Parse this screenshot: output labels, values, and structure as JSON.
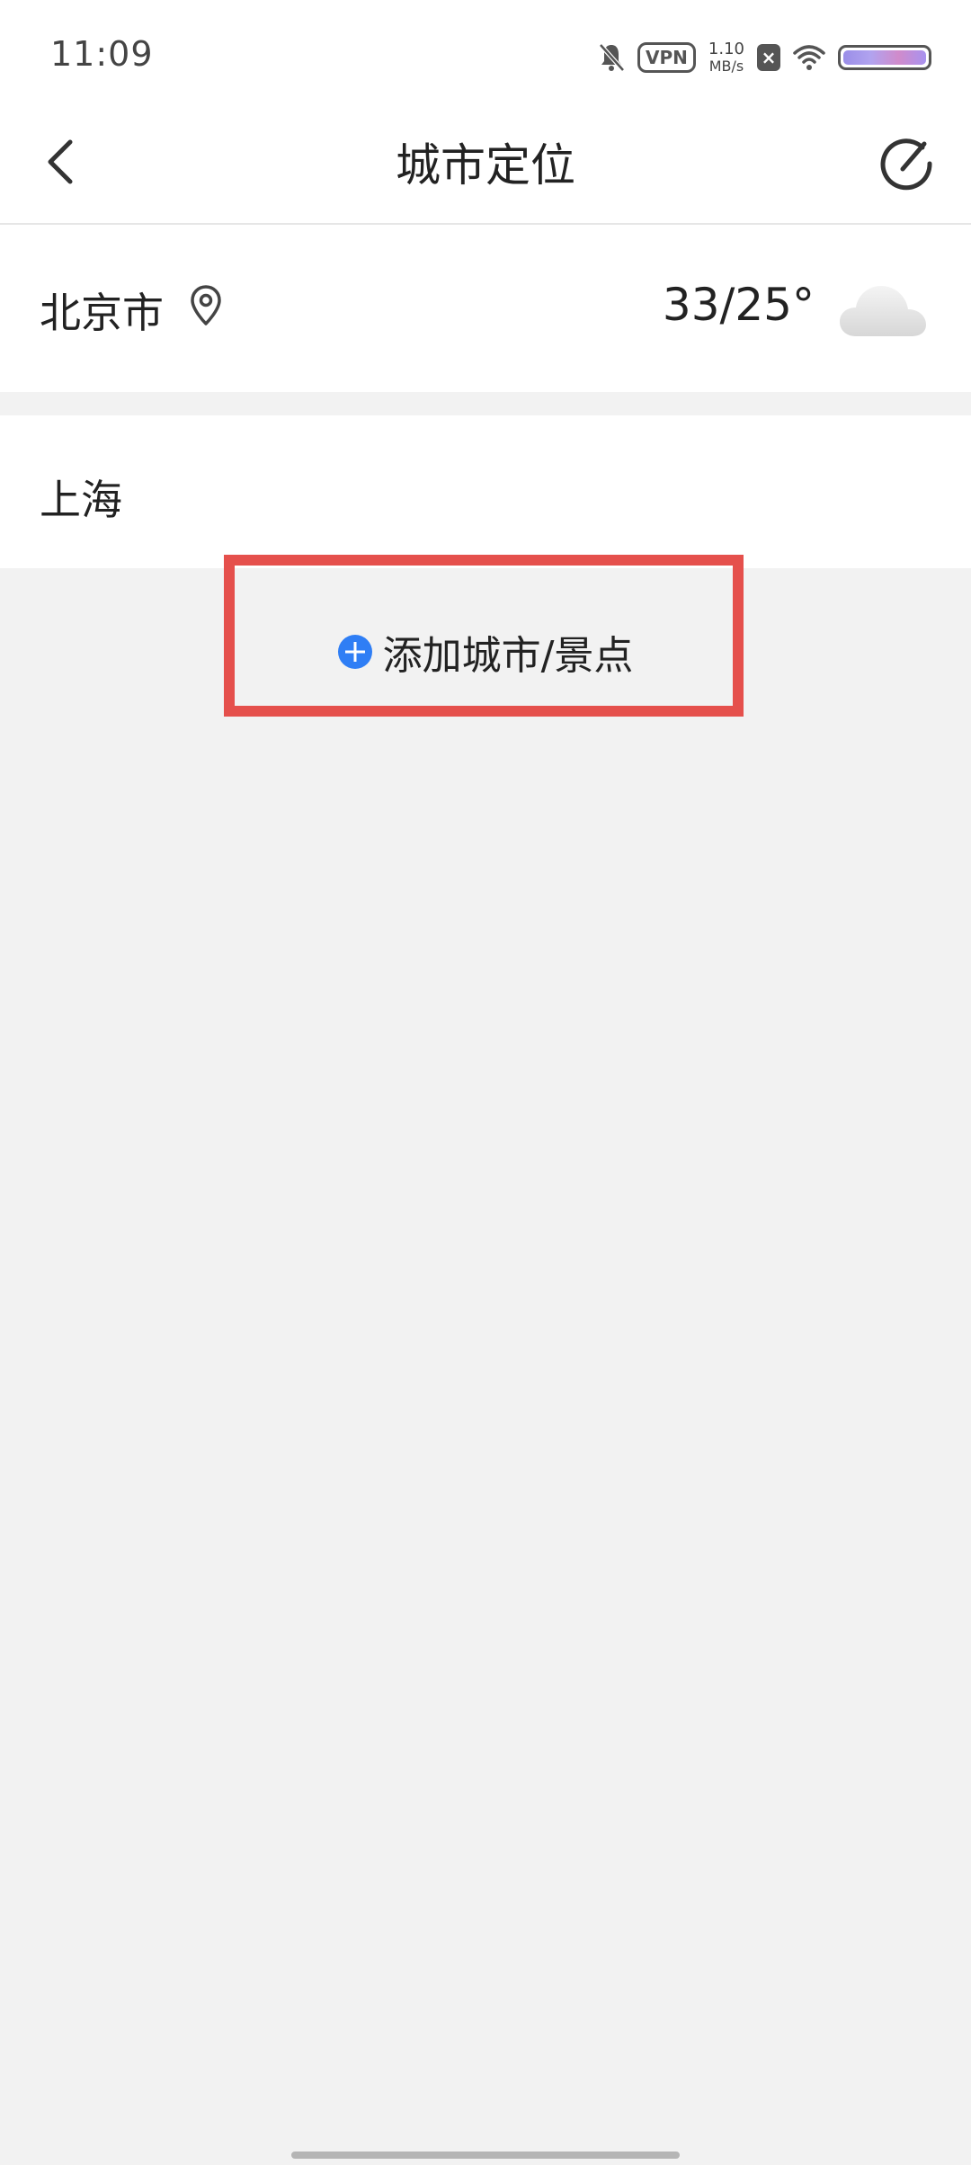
{
  "status_bar": {
    "time": "11:09",
    "vpn": "VPN",
    "net_speed_value": "1.10",
    "net_speed_unit": "MB/s",
    "icons": [
      "bell-muted-icon",
      "vpn-icon",
      "sim-x-icon",
      "wifi-icon",
      "battery-icon"
    ]
  },
  "header": {
    "title": "城市定位",
    "back_icon": "chevron-left-icon",
    "edit_icon": "check-circle-icon"
  },
  "cities": [
    {
      "name": "北京市",
      "located": true,
      "temp": "33/25°",
      "weather_icon": "cloudy-icon"
    },
    {
      "name": "上海"
    }
  ],
  "add_city": {
    "label": "添加城市/景点",
    "icon": "plus-circle-icon"
  },
  "colors": {
    "accent": "#2f7ef5",
    "highlight": "#e5504c",
    "background": "#f2f2f2"
  }
}
